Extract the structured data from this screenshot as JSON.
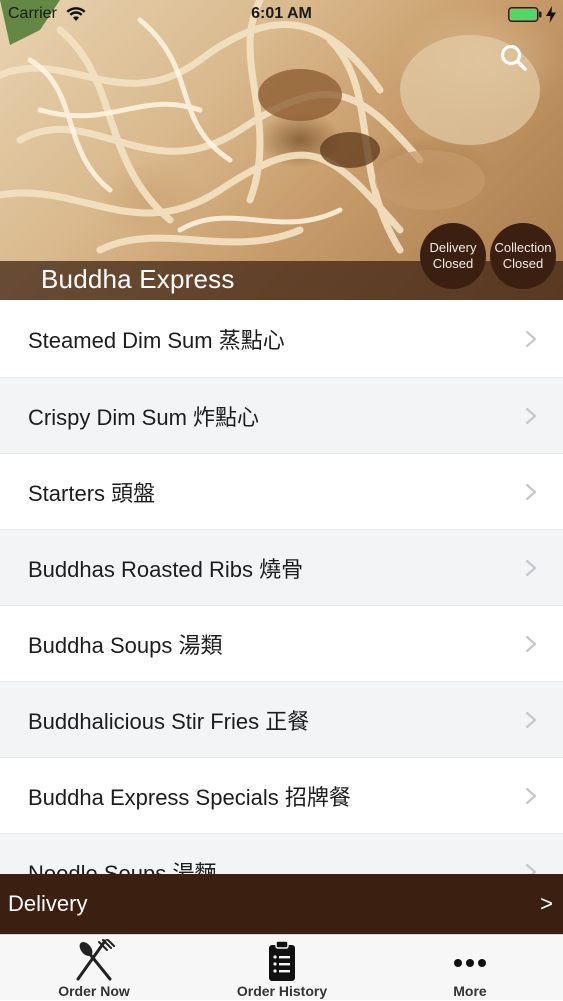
{
  "status_bar": {
    "carrier": "Carrier",
    "time": "6:01 AM"
  },
  "header": {
    "restaurant_name": "Buddha Express",
    "delivery_badge": {
      "line1": "Delivery",
      "line2": "Closed"
    },
    "collection_badge": {
      "line1": "Collection",
      "line2": "Closed"
    },
    "search_icon": "search-icon"
  },
  "menu": {
    "items": [
      {
        "label": "Steamed Dim Sum  蒸點心"
      },
      {
        "label": "Crispy Dim Sum  炸點心"
      },
      {
        "label": "Starters  頭盤"
      },
      {
        "label": "Buddhas Roasted Ribs  燒骨"
      },
      {
        "label": "Buddha Soups  湯類"
      },
      {
        "label": "Buddhalicious Stir Fries  正餐"
      },
      {
        "label": "Buddha Express Specials  招牌餐"
      },
      {
        "label": "Noodle Soups  湯麵"
      }
    ]
  },
  "delivery_bar": {
    "label": "Delivery",
    "arrow": ">"
  },
  "tab_bar": {
    "tabs": [
      {
        "label": "Order Now",
        "icon": "fork-spoon-icon"
      },
      {
        "label": "Order History",
        "icon": "clipboard-list-icon"
      },
      {
        "label": "More",
        "icon": "more-dots-icon"
      }
    ]
  },
  "colors": {
    "brand_dark_brown": "#3b1f10",
    "row_alt_background": "#f2f4f6",
    "chevron": "#c7c7cc",
    "tab_bar_background": "#f7f7f7"
  }
}
